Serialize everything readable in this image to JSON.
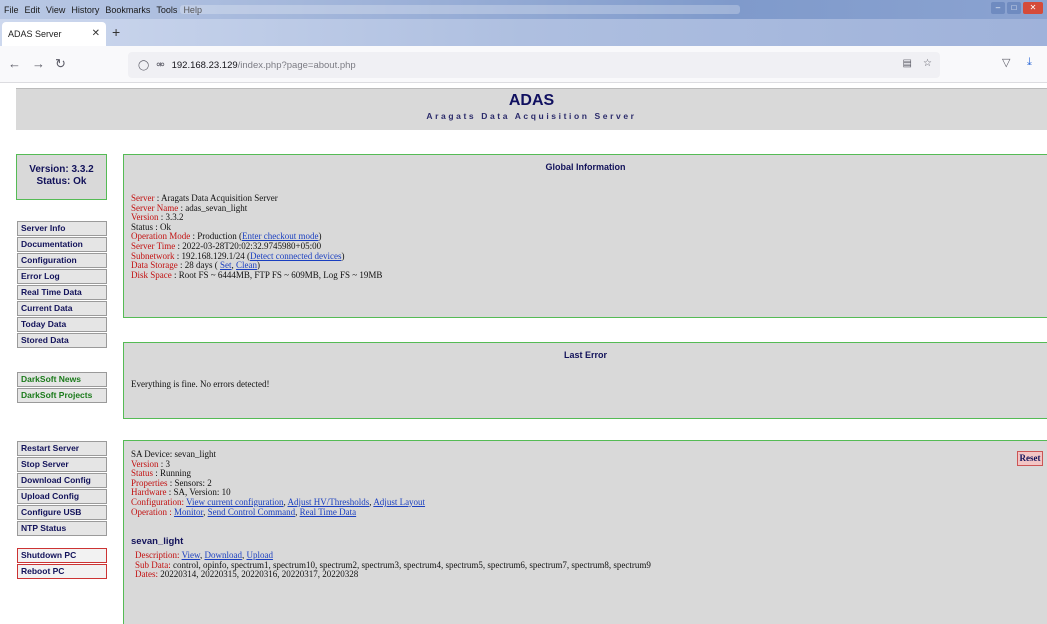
{
  "browser": {
    "menu": [
      "File",
      "Edit",
      "View",
      "History",
      "Bookmarks",
      "Tools",
      "Help"
    ],
    "tab_title": "ADAS Server",
    "url_host": "192.168.23.129",
    "url_path": "/index.php?page=about.php"
  },
  "header": {
    "title": "ADAS",
    "subtitle": "Aragats Data Acquisition Server"
  },
  "status_box": {
    "version": "Version: 3.3.2",
    "status": "Status: Ok"
  },
  "sidebar": {
    "nav": [
      "Server Info",
      "Documentation",
      "Configuration",
      "Error Log",
      "Real Time Data",
      "Current Data",
      "Today Data",
      "Stored Data"
    ],
    "news": [
      "DarkSoft News",
      "DarkSoft Projects"
    ],
    "actions": [
      "Restart Server",
      "Stop Server",
      "Download Config",
      "Upload Config",
      "Configure USB",
      "NTP Status"
    ],
    "power": [
      "Shutdown PC",
      "Reboot PC"
    ]
  },
  "global_info": {
    "title": "Global Information",
    "server_k": "Server",
    "server_v": " : Aragats Data Acquisition Server",
    "name_k": "Server Name",
    "name_v": " : adas_sevan_light",
    "version_k": "Version",
    "version_v": " : 3.3.2",
    "status_k": "Status",
    "status_v": " : Ok",
    "mode_k": "Operation Mode",
    "mode_v": " : Production (",
    "mode_link": "Enter checkout mode",
    "mode_end": ")",
    "time_k": "Server Time",
    "time_v": " : 2022-03-28T20:02:32.9745980+05:00",
    "subnet_k": "Subnetwork",
    "subnet_v": " : 192.168.129.1/24 (",
    "subnet_link": "Detect connected devices",
    "subnet_end": ")",
    "storage_k": "Data Storage",
    "storage_v": " : 28 days ( ",
    "storage_link1": "Set",
    "storage_sep": ", ",
    "storage_link2": "Clean",
    "storage_end": ")",
    "disk_k": "Disk Space",
    "disk_v": " : Root FS ~ 6444MB, FTP FS ~ 609MB, Log FS ~ 19MB"
  },
  "last_error": {
    "title": "Last Error",
    "message": "Everything is fine. No errors detected!"
  },
  "device": {
    "reset_label": "Reset",
    "sa_device": "SA Device: sevan_light",
    "version_k": "Version",
    "version_v": " : 3",
    "status_k": "Status",
    "status_v": " : Running",
    "props_k": "Properties",
    "props_v": " : Sensors: 2",
    "hw_k": "Hardware",
    "hw_v": " : SA, Version: 10",
    "config_k": "Configuration:",
    "config_l1": "View current configuration",
    "config_l2": "Adjust HV/Thresholds",
    "config_l3": "Adjust Layout",
    "op_k": "Operation :",
    "op_l1": "Monitor",
    "op_l2": "Send Control Command",
    "op_l3": "Real Time Data",
    "sub_name": "sevan_light",
    "desc_k": "Description:",
    "desc_l1": "View",
    "desc_l2": "Download",
    "desc_l3": "Upload",
    "subdata_k": "Sub Data:",
    "subdata_v": " control, opinfo, spectrum1, spectrum10, spectrum2, spectrum3, spectrum4, spectrum5, spectrum6, spectrum7, spectrum8, spectrum9",
    "dates_k": "Dates:",
    "dates_v": " 20220314, 20220315, 20220316, 20220317, 20220328"
  }
}
